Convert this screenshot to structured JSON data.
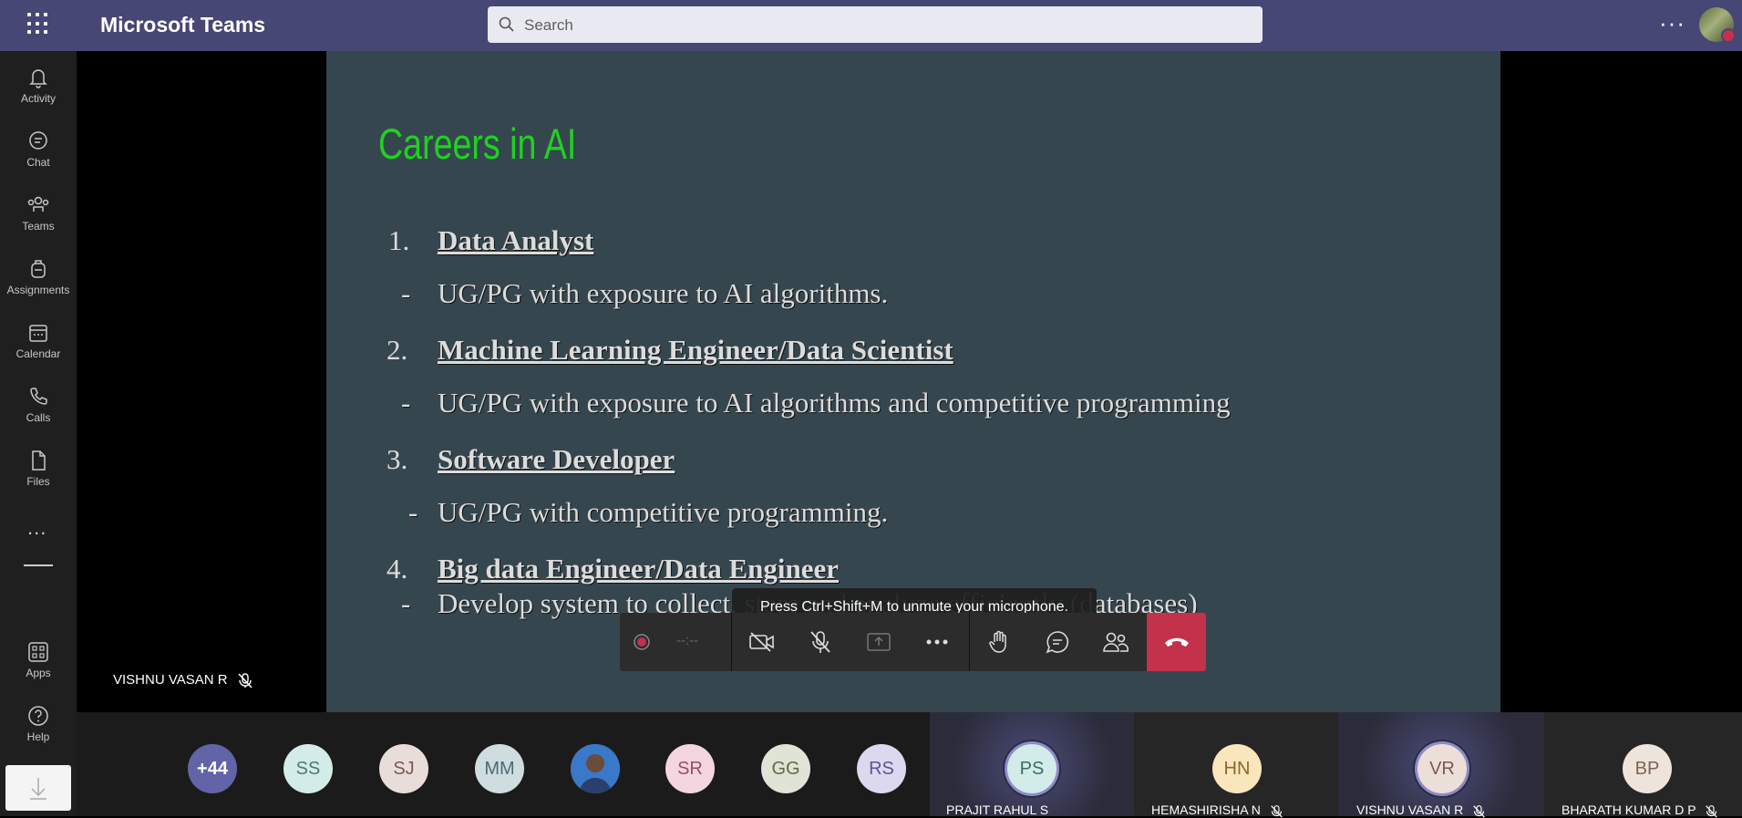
{
  "app": {
    "title": "Microsoft Teams"
  },
  "search": {
    "placeholder": "Search"
  },
  "rail": {
    "items": [
      {
        "label": "Activity"
      },
      {
        "label": "Chat"
      },
      {
        "label": "Teams"
      },
      {
        "label": "Assignments"
      },
      {
        "label": "Calendar"
      },
      {
        "label": "Calls"
      },
      {
        "label": "Files"
      },
      {
        "label": "Apps"
      },
      {
        "label": "Help"
      }
    ],
    "more": "..."
  },
  "slide": {
    "title": "Careers in AI",
    "items": [
      {
        "num": "1.",
        "heading": "Data Analyst",
        "dash": "-",
        "desc": "UG/PG with exposure to AI algorithms."
      },
      {
        "num": "2.",
        "heading": "Machine Learning Engineer/Data Scientist",
        "dash": "-",
        "desc": "UG/PG with exposure to AI algorithms and  competitive programming"
      },
      {
        "num": "3.",
        "heading": "Software Developer",
        "dash": "-",
        "desc": "UG/PG with  competitive programming."
      },
      {
        "num": "4.",
        "heading": "Big data Engineer/Data Engineer",
        "dash": "-",
        "desc": "Develop system to collect, store and analyze efficiently (databases)"
      }
    ]
  },
  "toast": {
    "text": "Press Ctrl+Shift+M to unmute your microphone."
  },
  "controls": {
    "timer": "--:--"
  },
  "speaker": {
    "name": "VISHNU VASAN R"
  },
  "participants": {
    "overflow": "+44",
    "avatars": [
      {
        "initials": "SS",
        "bg": "#d3ebe9",
        "fg": "#4a7c78"
      },
      {
        "initials": "SJ",
        "bg": "#e8ddd9",
        "fg": "#7c5a52"
      },
      {
        "initials": "MM",
        "bg": "#cfdde0",
        "fg": "#4b6a72"
      },
      {
        "initials": "",
        "bg": "#3a78c9",
        "fg": "#fff"
      },
      {
        "initials": "SR",
        "bg": "#f3d6e0",
        "fg": "#9b4c6a"
      },
      {
        "initials": "GG",
        "bg": "#dfe4d6",
        "fg": "#5e6b4a"
      },
      {
        "initials": "RS",
        "bg": "#dcd9ef",
        "fg": "#5b5591"
      }
    ],
    "tiles": [
      {
        "initials": "PS",
        "name": "PRAJIT RAHUL S",
        "bg": "#d3ebe9",
        "fg": "#3a6c68"
      },
      {
        "initials": "HN",
        "name": "HEMASHIRISHA N",
        "bg": "#f9e6bd",
        "fg": "#8a6a2a"
      },
      {
        "initials": "VR",
        "name": "VISHNU VASAN R",
        "bg": "#ecdfd9",
        "fg": "#7c5a52"
      },
      {
        "initials": "BP",
        "name": "BHARATH KUMAR D P",
        "bg": "#eee4dc",
        "fg": "#7c6452"
      }
    ]
  },
  "colors": {
    "header": "#464775",
    "slide_bg": "#36464f",
    "title_green": "#1fd21f",
    "hangup": "#c4314b"
  }
}
